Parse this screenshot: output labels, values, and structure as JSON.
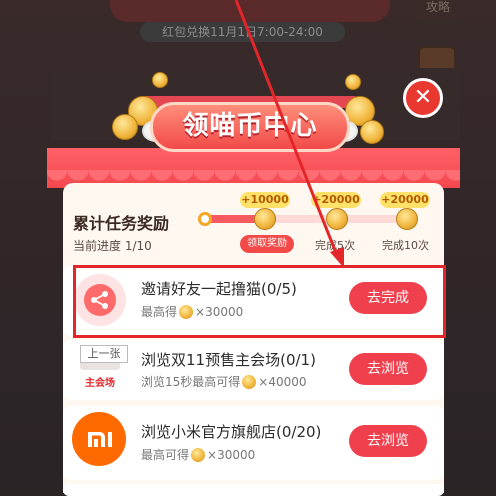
{
  "background": {
    "event_title": "",
    "redeem_time": "红包兑换11月1日7:00-24:00",
    "right_tab": "攻略"
  },
  "close_icon": "close-icon",
  "banner": {
    "title": "领喵币中心"
  },
  "cumulative": {
    "title": "累计任务奖励",
    "progress": "当前进度 1/10",
    "milestones": [
      {
        "reward": "+10000",
        "label": "领取奖励"
      },
      {
        "reward": "+20000",
        "label": "完成5次"
      },
      {
        "reward": "+20000",
        "label": "完成10次"
      }
    ]
  },
  "tasks": [
    {
      "title": "邀请好友一起撸猫(0/5)",
      "prefix": "最高得",
      "amount": "×30000",
      "button": "去完成",
      "icon": "share-icon"
    },
    {
      "title": "浏览双11预售主会场(0/1)",
      "prefix": "浏览15秒最高可得",
      "amount": "×40000",
      "button": "去浏览",
      "icon_text": "主会场",
      "icon": "venue-icon"
    },
    {
      "title": "浏览小米官方旗舰店(0/20)",
      "prefix": "最高可得",
      "amount": "×30000",
      "button": "去浏览",
      "icon": "xiaomi-logo-icon"
    }
  ],
  "overlay": {
    "prev_tag": "上一张"
  },
  "colors": {
    "accent_red": "#f0404e",
    "highlight_red": "#e3262a",
    "coin_gold": "#f0b43a"
  }
}
